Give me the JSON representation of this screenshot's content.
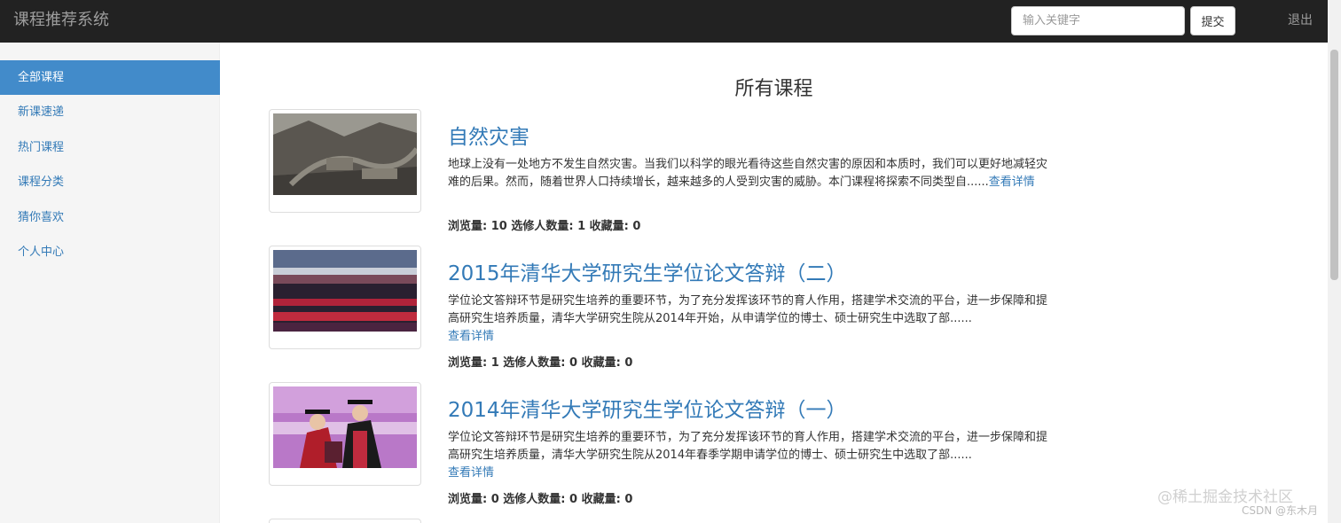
{
  "app": {
    "title": "课程推荐系统"
  },
  "header": {
    "search_placeholder": "输入关键字",
    "submit_label": "提交",
    "logout_label": "退出"
  },
  "sidebar": {
    "items": [
      {
        "label": "全部课程",
        "active": true
      },
      {
        "label": "新课速递",
        "active": false
      },
      {
        "label": "热门课程",
        "active": false
      },
      {
        "label": "课程分类",
        "active": false
      },
      {
        "label": "猜你喜欢",
        "active": false
      },
      {
        "label": "个人中心",
        "active": false
      }
    ]
  },
  "main": {
    "title": "所有课程",
    "detail_label": "查看详情",
    "courses": [
      {
        "title": "自然灾害",
        "description": "地球上没有一处地方不发生自然灾害。当我们以科学的眼光看待这些自然灾害的原因和本质时，我们可以更好地减轻灾难的后果。然而，随着世界人口持续增长，越来越多的人受到灾害的威胁。本门课程将探索不同类型自......",
        "stats": "浏览量: 10 选修人数量: 1 收藏量: 0"
      },
      {
        "title": "2015年清华大学研究生学位论文答辩（二）",
        "description": "学位论文答辩环节是研究生培养的重要环节，为了充分发挥该环节的育人作用，搭建学术交流的平台，进一步保障和提高研究生培养质量，清华大学研究生院从2014年开始，从申请学位的博士、硕士研究生中选取了部......",
        "stats": "浏览量: 1 选修人数量: 0 收藏量: 0"
      },
      {
        "title": "2014年清华大学研究生学位论文答辩（一）",
        "description": "学位论文答辩环节是研究生培养的重要环节，为了充分发挥该环节的育人作用，搭建学术交流的平台，进一步保障和提高研究生培养质量，清华大学研究生院从2014年春季学期申请学位的博士、硕士研究生中选取了部......",
        "stats": "浏览量: 0 选修人数量: 0 收藏量: 0"
      }
    ]
  },
  "watermark": {
    "line1": "@稀土掘金技术社区",
    "line2": "CSDN @东木月"
  },
  "colors": {
    "navbar_bg": "#222222",
    "accent": "#428bca",
    "link": "#337ab7"
  }
}
